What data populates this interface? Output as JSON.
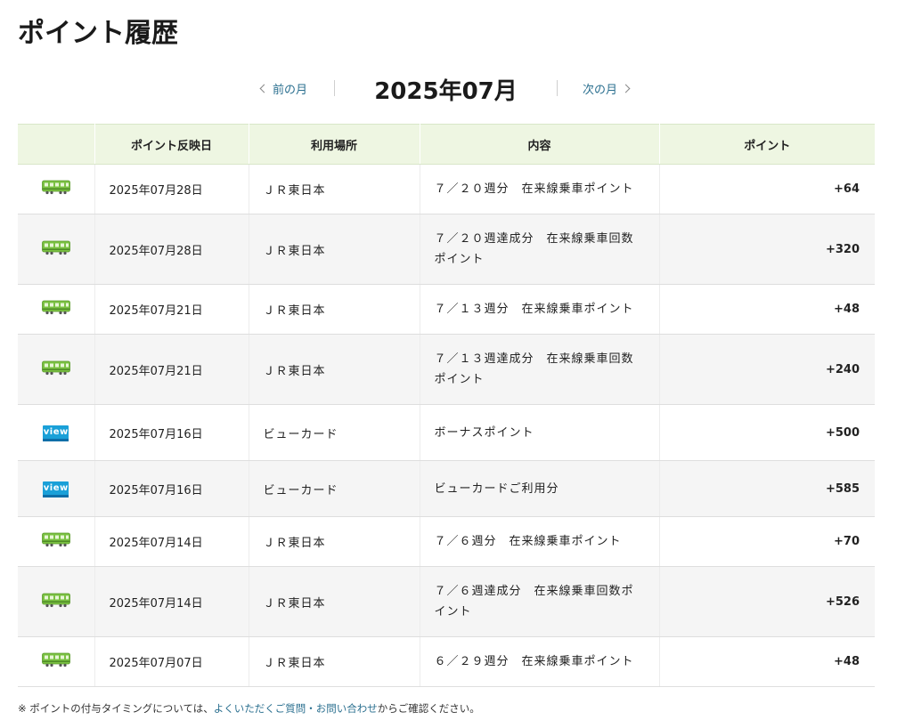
{
  "page": {
    "title": "ポイント履歴"
  },
  "month_nav": {
    "prev_label": "前の月",
    "current": "2025年07月",
    "next_label": "次の月"
  },
  "table": {
    "headers": {
      "icon": "",
      "date": "ポイント反映日",
      "place": "利用場所",
      "content": "内容",
      "point": "ポイント"
    },
    "rows": [
      {
        "icon": "train-icon",
        "date": "2025年07月28日",
        "place": "ＪＲ東日本",
        "content": "７／２０週分　在来線乗車ポイント",
        "point": "+64"
      },
      {
        "icon": "train-icon",
        "date": "2025年07月28日",
        "place": "ＪＲ東日本",
        "content": "７／２０週達成分　在来線乗車回数ポイント",
        "point": "+320"
      },
      {
        "icon": "train-icon",
        "date": "2025年07月21日",
        "place": "ＪＲ東日本",
        "content": "７／１３週分　在来線乗車ポイント",
        "point": "+48"
      },
      {
        "icon": "train-icon",
        "date": "2025年07月21日",
        "place": "ＪＲ東日本",
        "content": "７／１３週達成分　在来線乗車回数ポイント",
        "point": "+240"
      },
      {
        "icon": "view-card-icon",
        "icon_text": "view",
        "date": "2025年07月16日",
        "place": "ビューカード",
        "content": "ボーナスポイント",
        "point": "+500"
      },
      {
        "icon": "view-card-icon",
        "icon_text": "view",
        "date": "2025年07月16日",
        "place": "ビューカード",
        "content": "ビューカードご利用分",
        "point": "+585"
      },
      {
        "icon": "train-icon",
        "date": "2025年07月14日",
        "place": "ＪＲ東日本",
        "content": "７／６週分　在来線乗車ポイント",
        "point": "+70"
      },
      {
        "icon": "train-icon",
        "date": "2025年07月14日",
        "place": "ＪＲ東日本",
        "content": "７／６週達成分　在来線乗車回数ポイント",
        "point": "+526"
      },
      {
        "icon": "train-icon",
        "date": "2025年07月07日",
        "place": "ＪＲ東日本",
        "content": "６／２９週分　在来線乗車ポイント",
        "point": "+48"
      }
    ]
  },
  "footnote": {
    "prefix": "※ ポイントの付与タイミングについては、",
    "link": "よくいただくご質問・お問い合わせ",
    "suffix": "からご確認ください。"
  },
  "colors": {
    "header_bg": "#eef6e2",
    "link": "#2a6f8f",
    "train_green": "#7ac142",
    "view_blue": "#1aa0d8"
  }
}
